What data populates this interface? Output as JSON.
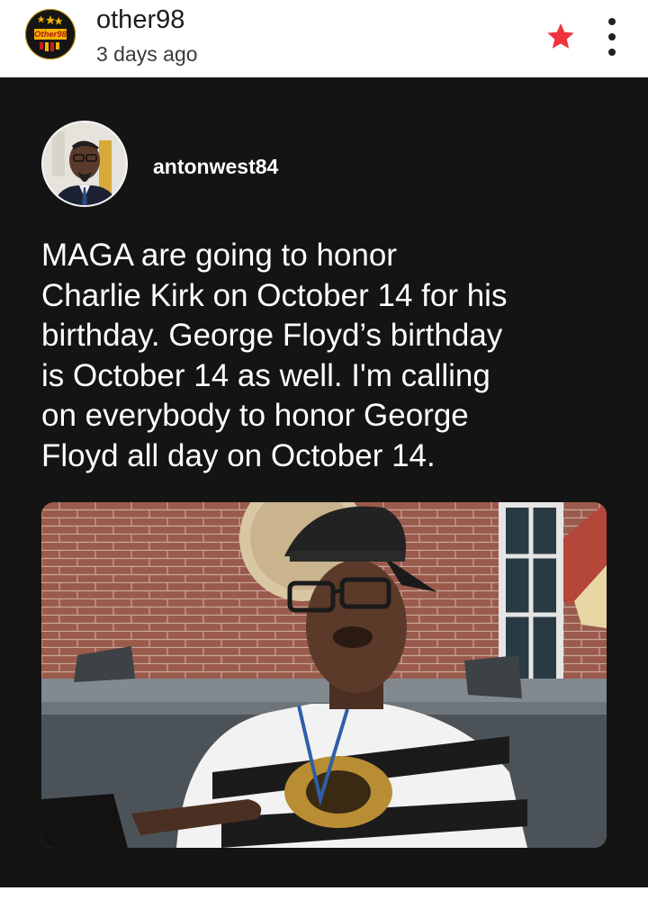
{
  "header": {
    "logo_text": "Other98",
    "username": "other98",
    "timestamp": "3 days ago",
    "icons": {
      "favorite": "star-icon",
      "menu": "more-vertical-icon"
    },
    "colors": {
      "star": "#f0343d",
      "logo_gold": "#f2b400"
    }
  },
  "post": {
    "author": "antonwest84",
    "text": "MAGA are going to honor\nCharlie Kirk on October 14 for his\nbirthday. George Floyd’s birthday\nis October 14 as well. I'm calling\non everybody to honor George\nFloyd all day on October 14.",
    "photo_icon": "photo-image",
    "colors": {
      "panel_bg": "#141414",
      "text": "#ffffff"
    }
  }
}
